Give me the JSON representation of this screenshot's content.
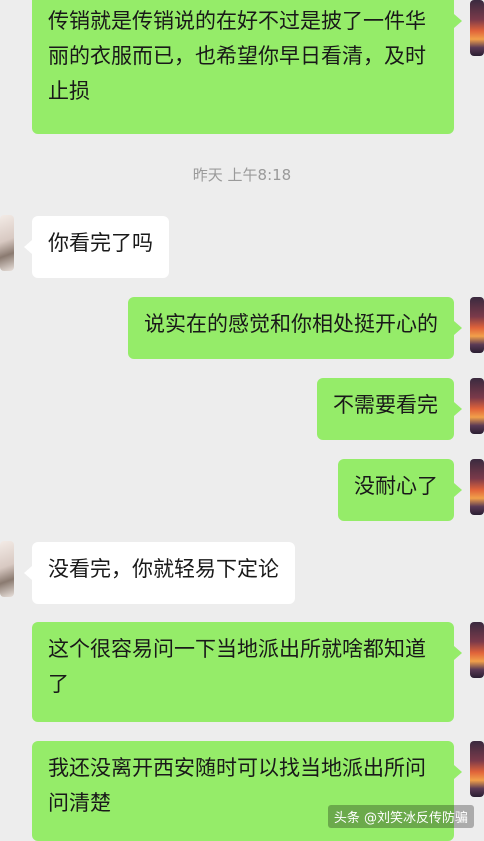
{
  "timestamp": "昨天 上午8:18",
  "messages": [
    {
      "text": "传销就是传销说的在好不过是披了一件华丽的衣服而已，也希望你早日看清，及时止损"
    },
    {
      "text": "你看完了吗"
    },
    {
      "text": "说实在的感觉和你相处挺开心的"
    },
    {
      "text": "不需要看完"
    },
    {
      "text": "没耐心了"
    },
    {
      "text": "没看完，你就轻易下定论"
    },
    {
      "text": "这个很容易问一下当地派出所就啥都知道了"
    },
    {
      "text": "我还没离开西安随时可以找当地派出所问问清楚"
    }
  ],
  "watermark": "头条 @刘笑冰反传防骗",
  "colors": {
    "background": "#ededed",
    "self_bubble": "#95ec69",
    "peer_bubble": "#ffffff",
    "timestamp_text": "#9a9a9a"
  }
}
